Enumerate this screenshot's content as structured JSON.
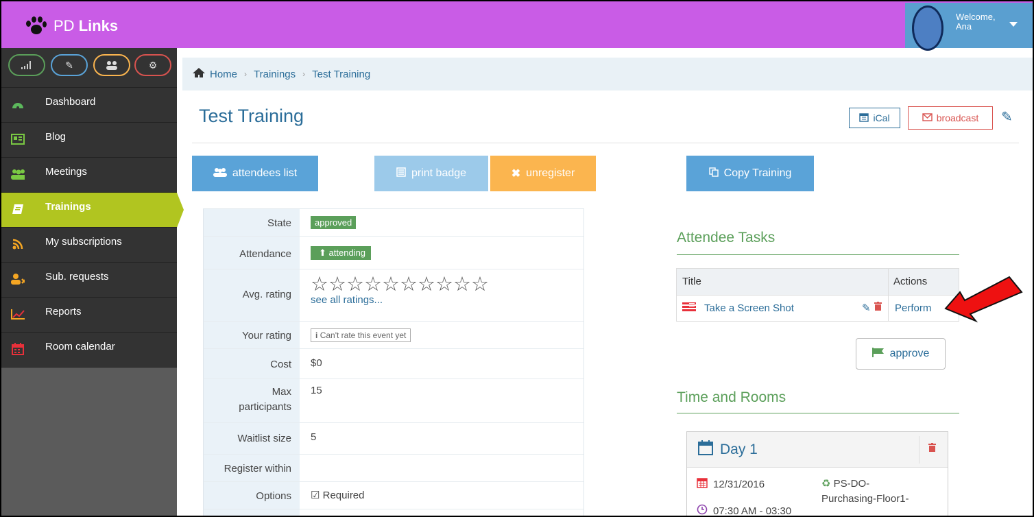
{
  "app": {
    "brand_prefix": "PD",
    "brand_name": "Links",
    "welcome_line1": "Welcome,",
    "welcome_line2": "Ana"
  },
  "sidebar": {
    "top_buttons": [
      "signal-icon",
      "pencil-icon",
      "group-icon",
      "cogs-icon"
    ],
    "items": [
      {
        "label": "Dashboard",
        "icon": "dashboard-icon",
        "icon_color": "#5cb85c"
      },
      {
        "label": "Blog",
        "icon": "newspaper-icon",
        "icon_color": "#7ac943"
      },
      {
        "label": "Meetings",
        "icon": "group-icon",
        "icon_color": "#7ac943"
      },
      {
        "label": "Trainings",
        "icon": "book-icon",
        "active": true
      },
      {
        "label": "My subscriptions",
        "icon": "rss-icon",
        "icon_color": "#f5a623"
      },
      {
        "label": "Sub. requests",
        "icon": "user-remove-icon",
        "icon_color": "#f5a623"
      },
      {
        "label": "Reports",
        "icon": "chart-line-icon",
        "icon_color": "#f5a623"
      },
      {
        "label": "Room calendar",
        "icon": "calendar-icon",
        "icon_color": "#e8303a"
      }
    ]
  },
  "breadcrumb": {
    "home": "Home",
    "trainings": "Trainings",
    "current": "Test Training"
  },
  "page": {
    "title": "Test Training",
    "ical": "iCal",
    "broadcast": "broadcast",
    "actions": {
      "attendees": "attendees list",
      "print": "print badge",
      "unregister": "unregister",
      "copy": "Copy Training"
    }
  },
  "details": {
    "state_label": "State",
    "state_value": "approved",
    "attendance_label": "Attendance",
    "attendance_value": "attending",
    "avg_rating_label": "Avg. rating",
    "avg_rating_stars": "☆☆☆☆☆☆☆☆☆☆",
    "see_all": "see all ratings...",
    "your_rating_label": "Your rating",
    "your_rating_value": "Can't rate this event yet",
    "cost_label": "Cost",
    "cost_value": "$0",
    "max_label_1": "Max",
    "max_label_2": "participants",
    "max_value": "15",
    "waitlist_label": "Waitlist size",
    "waitlist_value": "5",
    "register_label": "Register within",
    "options_label": "Options",
    "options_value": "Required"
  },
  "tasks": {
    "section_title": "Attendee Tasks",
    "col_title": "Title",
    "col_actions": "Actions",
    "rows": [
      {
        "title": "Take a Screen Shot",
        "action": "Perform"
      }
    ],
    "approve": "approve"
  },
  "time_rooms": {
    "section_title": "Time and Rooms",
    "day": "Day 1",
    "date": "12/31/2016",
    "time": "07:30 AM - 03:30",
    "room_line1": "PS-DO-",
    "room_line2": "Purchasing-Floor1-"
  },
  "colors": {
    "topbar": "#c95ce6",
    "sidebar_active": "#b1c520",
    "link": "#2b6d99",
    "green": "#5b9f5a",
    "warning": "#fbb54f",
    "danger": "#d9534f"
  }
}
